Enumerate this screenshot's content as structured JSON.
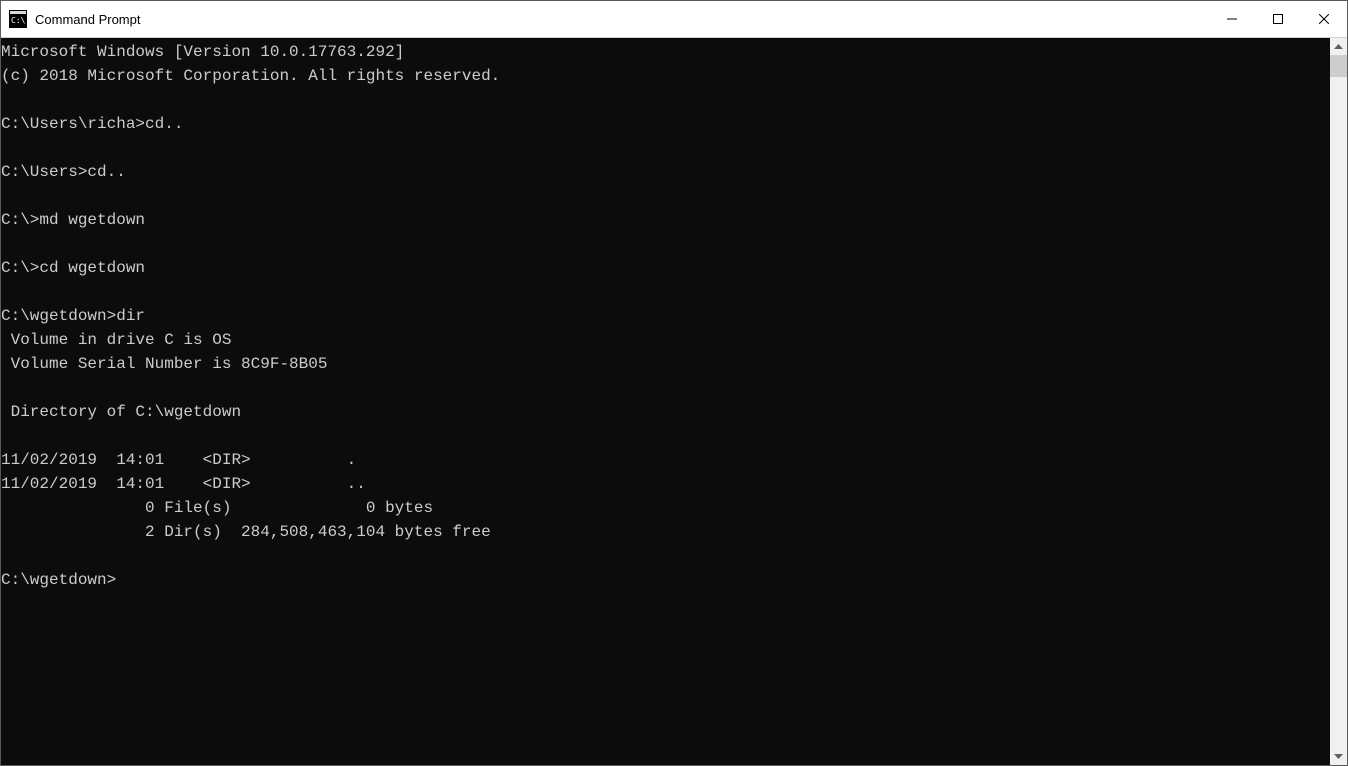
{
  "window": {
    "title": "Command Prompt"
  },
  "terminal": {
    "lines": [
      "Microsoft Windows [Version 10.0.17763.292]",
      "(c) 2018 Microsoft Corporation. All rights reserved.",
      "",
      "C:\\Users\\richa>cd..",
      "",
      "C:\\Users>cd..",
      "",
      "C:\\>md wgetdown",
      "",
      "C:\\>cd wgetdown",
      "",
      "C:\\wgetdown>dir",
      " Volume in drive C is OS",
      " Volume Serial Number is 8C9F-8B05",
      "",
      " Directory of C:\\wgetdown",
      "",
      "11/02/2019  14:01    <DIR>          .",
      "11/02/2019  14:01    <DIR>          ..",
      "               0 File(s)              0 bytes",
      "               2 Dir(s)  284,508,463,104 bytes free",
      "",
      "C:\\wgetdown>"
    ]
  }
}
